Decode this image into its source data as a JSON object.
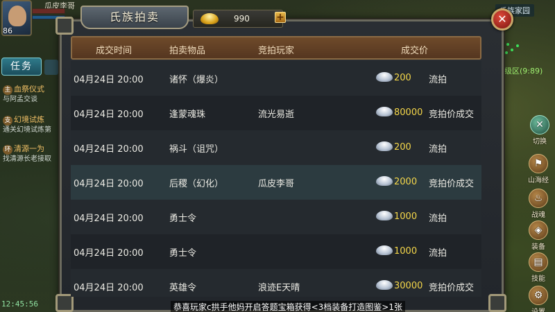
{
  "hud": {
    "player_name": "瓜皮李哥",
    "level": "86",
    "task_tab": "任务",
    "quests": [
      {
        "badge": "主",
        "title": "血祭仪式",
        "desc": "与阿孟交谈"
      },
      {
        "badge": "支",
        "title": "幻境试炼",
        "desc": "通关幻境试炼第"
      },
      {
        "badge": "环",
        "title": "清源一为",
        "desc": "找清源长老接取"
      }
    ],
    "clock": "12:45:56",
    "map_label": "氏族家园",
    "zone_label": "练级区(9:89)"
  },
  "side_buttons": [
    {
      "name": "switch",
      "label": "切换",
      "icon": "swap-icon"
    },
    {
      "name": "shanhaijing",
      "label": "山海经",
      "icon": "scroll-icon"
    },
    {
      "name": "zhanhun",
      "label": "战魂",
      "icon": "flame-icon"
    },
    {
      "name": "equipment",
      "label": "装备",
      "icon": "armor-icon"
    },
    {
      "name": "skills",
      "label": "技能",
      "icon": "book-icon"
    },
    {
      "name": "settings",
      "label": "设置",
      "icon": "gear-icon"
    }
  ],
  "panel": {
    "title": "氏族拍卖",
    "currency_value": "990",
    "plus_label": "+",
    "close_label": "✕",
    "columns": [
      "成交时间",
      "拍卖物品",
      "竞拍玩家",
      "成交价"
    ]
  },
  "auction_rows": [
    {
      "time": "04月24日 20:00",
      "item": "诸怀（爆炎）",
      "player": "",
      "price": "200",
      "status": "流拍"
    },
    {
      "time": "04月24日 20:00",
      "item": "逢蒙魂珠",
      "player": "流光易逝",
      "price": "80000",
      "status": "竞拍价成交"
    },
    {
      "time": "04月24日 20:00",
      "item": "祸斗（诅咒）",
      "player": "",
      "price": "200",
      "status": "流拍"
    },
    {
      "time": "04月24日 20:00",
      "item": "后稷（幻化）",
      "player": "瓜皮李哥",
      "price": "2000",
      "status": "竞拍价成交"
    },
    {
      "time": "04月24日 20:00",
      "item": "勇士令",
      "player": "",
      "price": "1000",
      "status": "流拍"
    },
    {
      "time": "04月24日 20:00",
      "item": "勇士令",
      "player": "",
      "price": "1000",
      "status": "流拍"
    },
    {
      "time": "04月24日 20:00",
      "item": "英雄令",
      "player": "浪迹E天晴",
      "price": "30000",
      "status": "竞拍价成交"
    }
  ],
  "marquee": "恭喜玩家c拱手他妈开启答题宝箱获得<3档装备打造图鉴>1张"
}
